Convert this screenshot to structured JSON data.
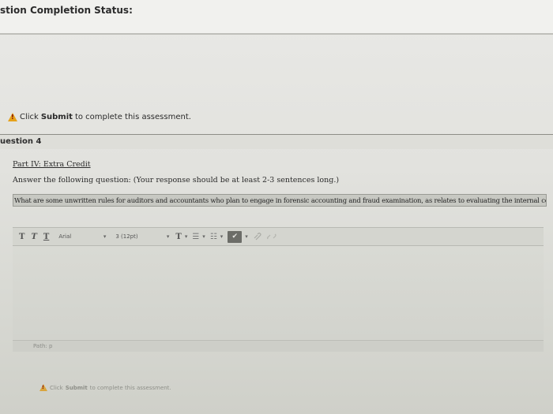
{
  "status": {
    "label": "stion Completion Status:"
  },
  "notice": {
    "prefix": "Click ",
    "action": "Submit",
    "suffix": " to complete this assessment."
  },
  "question": {
    "header": "uestion 4",
    "part_title": "Part IV: Extra Credit",
    "instruction": "Answer the following question: (Your response should be at least 2-3 sentences long.)",
    "text": "What are some unwritten rules for auditors and accountants who plan to engage in forensic accounting and fraud examination, as relates to evaluating the internal controls."
  },
  "toolbar": {
    "bold_label": "T",
    "italic_label": "T",
    "underline_label": "T",
    "font_family": "Arial",
    "font_size": "3 (12pt)",
    "text_color_label": "T",
    "caret": "▾",
    "list_unordered": "☰",
    "list_ordered": "☷",
    "spell": "✔",
    "link_icon": "link-icon",
    "unlink_icon": "unlink-icon"
  },
  "editor": {
    "value": "",
    "path_label": "Path: p"
  },
  "notice_bottom": {
    "prefix": "Click ",
    "action": "Submit",
    "suffix": " to complete this assessment."
  },
  "colors": {
    "warning": "#e6a21a",
    "background": "#e2e2de"
  }
}
